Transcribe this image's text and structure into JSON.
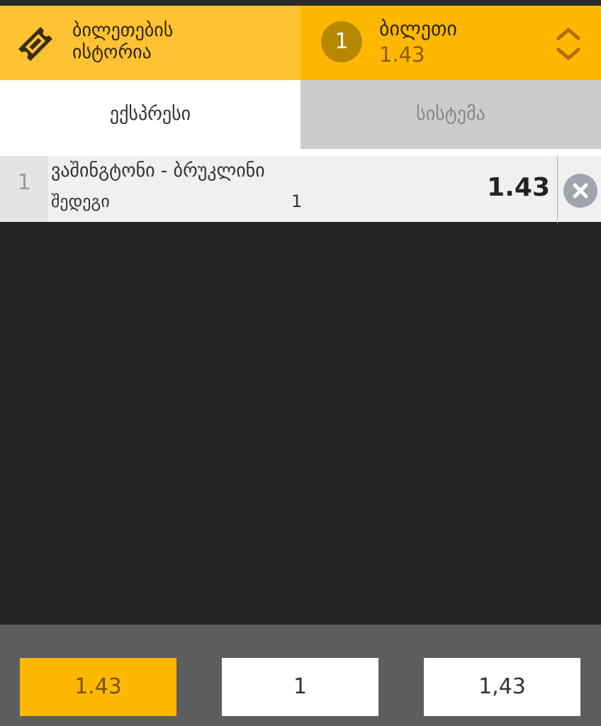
{
  "header": {
    "history_label_line1": "ბილეთების",
    "history_label_line2": "ისტორია",
    "ticket_count": "1",
    "ticket_title": "ბილეთი",
    "ticket_odds": "1.43"
  },
  "tabs": [
    {
      "label": "ექსპრესი",
      "active": true
    },
    {
      "label": "სისტემა",
      "active": false
    }
  ],
  "bets": [
    {
      "index": "1",
      "match": "ვაშინგტონი - ბრუკლინი",
      "market": "შედეგი",
      "outcome": "1",
      "odd": "1.43"
    }
  ],
  "footer": {
    "total_odds": "1.43",
    "stake": "1",
    "possible_win": "1,43"
  },
  "colors": {
    "accent_yellow": "#ffb800",
    "light_yellow": "#ffc233",
    "badge": "#b78700",
    "dark_bg": "#242424",
    "footer_bg": "#5d5d5d"
  },
  "icons": {
    "history": "ticket-icon",
    "toggle": "chevron-up-down-icon",
    "remove": "close-icon"
  }
}
